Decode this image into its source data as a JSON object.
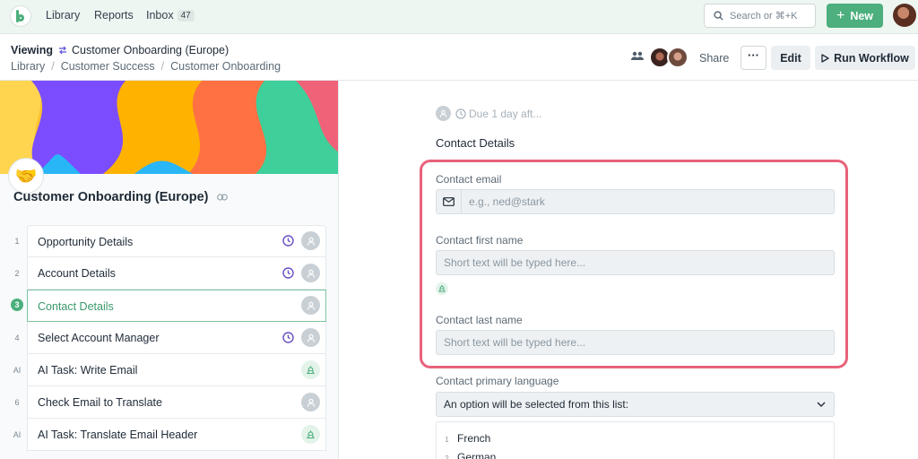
{
  "nav": {
    "links": [
      "Library",
      "Reports",
      "Inbox"
    ],
    "inbox_count": "47",
    "search_placeholder": "Search or ⌘+K",
    "new_label": "New"
  },
  "header": {
    "viewing_label": "Viewing",
    "workflow_name": "Customer Onboarding (Europe)",
    "breadcrumbs": [
      "Library",
      "Customer Success",
      "Customer Onboarding"
    ],
    "share_label": "Share",
    "more_label": "···",
    "edit_label": "Edit",
    "run_label": "Run Workflow"
  },
  "sidebar": {
    "emoji": "🤝",
    "title": "Customer Onboarding (Europe)",
    "tasks": [
      {
        "num": "1",
        "label": "Opportunity Details",
        "clock": true,
        "type": "avatar"
      },
      {
        "num": "2",
        "label": "Account Details",
        "clock": true,
        "type": "avatar"
      },
      {
        "num": "3",
        "label": "Contact Details",
        "clock": false,
        "type": "avatar",
        "active": true
      },
      {
        "num": "4",
        "label": "Select Account Manager",
        "clock": true,
        "type": "avatar"
      },
      {
        "num": "AI",
        "label": "AI Task: Write Email",
        "clock": false,
        "type": "ai"
      },
      {
        "num": "6",
        "label": "Check Email to Translate",
        "clock": false,
        "type": "avatar"
      },
      {
        "num": "AI",
        "label": "AI Task: Translate Email Header",
        "clock": false,
        "type": "ai"
      }
    ]
  },
  "main": {
    "due_text": "Due 1 day aft...",
    "section_title": "Contact Details",
    "fields": [
      {
        "label": "Contact email",
        "placeholder": "e.g., ned@stark"
      },
      {
        "label": "Contact first name",
        "placeholder": "Short text will be typed here..."
      },
      {
        "label": "Contact last name",
        "placeholder": "Short text will be typed here..."
      }
    ],
    "language": {
      "label": "Contact primary language",
      "select_text": "An option will be selected from this list:",
      "options": [
        "French",
        "German"
      ]
    }
  },
  "colors": {
    "brand_green": "#4caf7d",
    "highlight": "#e8627a",
    "clock_purple": "#6a4fc4"
  }
}
